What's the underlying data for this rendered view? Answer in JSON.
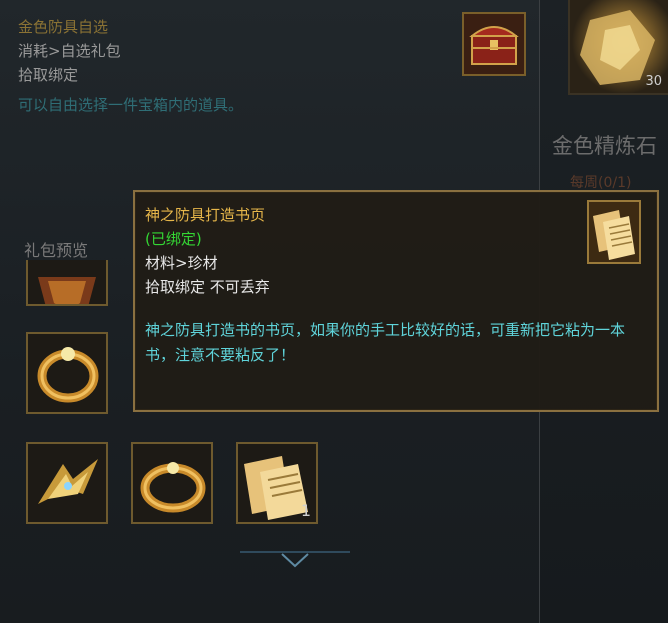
{
  "background_item": {
    "title": "金色精炼石",
    "sub": "每周(0/1)",
    "count": "30"
  },
  "main_panel": {
    "title": "金色防具自选",
    "category": "消耗>自选礼包",
    "bind": "拾取绑定",
    "description": "可以自由选择一件宝箱内的道具。",
    "preview_label": "礼包预览",
    "chest_icon": "treasure-chest-icon",
    "slots": [
      {
        "icon": "gold-helm-icon"
      },
      {
        "icon": "gold-ring-icon"
      },
      {
        "icon": "gold-ring-icon"
      },
      {
        "icon": "gold-ring-icon"
      },
      {
        "icon": "gold-ring-icon"
      },
      {
        "icon": "gold-ring-icon"
      },
      {
        "icon": "gold-wing-icon"
      },
      {
        "icon": "gold-ring-icon"
      },
      {
        "icon": "book-page-icon",
        "quantity": "1"
      }
    ],
    "more_icon": "chevron-down-icon"
  },
  "tooltip": {
    "title": "神之防具打造书页",
    "bound": "(已绑定)",
    "category": "材料>珍材",
    "bind": "拾取绑定 不可丢弃",
    "description": "神之防具打造书的书页，如果你的手工比较好的话，可重新把它粘为一本书，注意不要粘反了！",
    "icon": "book-page-icon"
  },
  "colors": {
    "gold_title": "#e6b64a",
    "bound_green": "#34d634",
    "desc_cyan": "#5fd4da",
    "frame_gold": "#8a7040"
  }
}
